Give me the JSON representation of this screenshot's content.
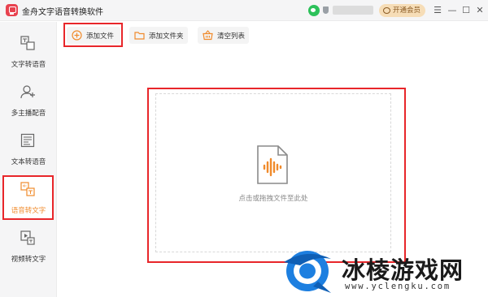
{
  "app": {
    "title": "金舟文字语音转换软件",
    "vip_button": "开通会员",
    "window_controls": {
      "menu": "☰",
      "minimize": "—",
      "maximize": "☐",
      "close": "✕"
    }
  },
  "sidebar": {
    "items": [
      {
        "label": "文字转语音",
        "icon": "text-to-speech-icon",
        "active": false
      },
      {
        "label": "多主播配音",
        "icon": "multi-voice-icon",
        "active": false
      },
      {
        "label": "文本转语音",
        "icon": "document-to-speech-icon",
        "active": false
      },
      {
        "label": "语音转文字",
        "icon": "speech-to-text-icon",
        "active": true
      },
      {
        "label": "视频转文字",
        "icon": "video-to-text-icon",
        "active": false
      }
    ]
  },
  "toolbar": {
    "add_file": "添加文件",
    "add_folder": "添加文件夹",
    "clear_list": "清空列表"
  },
  "dropzone": {
    "hint": "点击或拖拽文件至此处"
  },
  "watermark": {
    "text": "冰棱游戏网",
    "url": "www.yclengku.com"
  },
  "colors": {
    "accent": "#f08b2c",
    "highlight": "#e8262a",
    "wechat": "#2dc15a",
    "vip": "#f6ddb7"
  }
}
